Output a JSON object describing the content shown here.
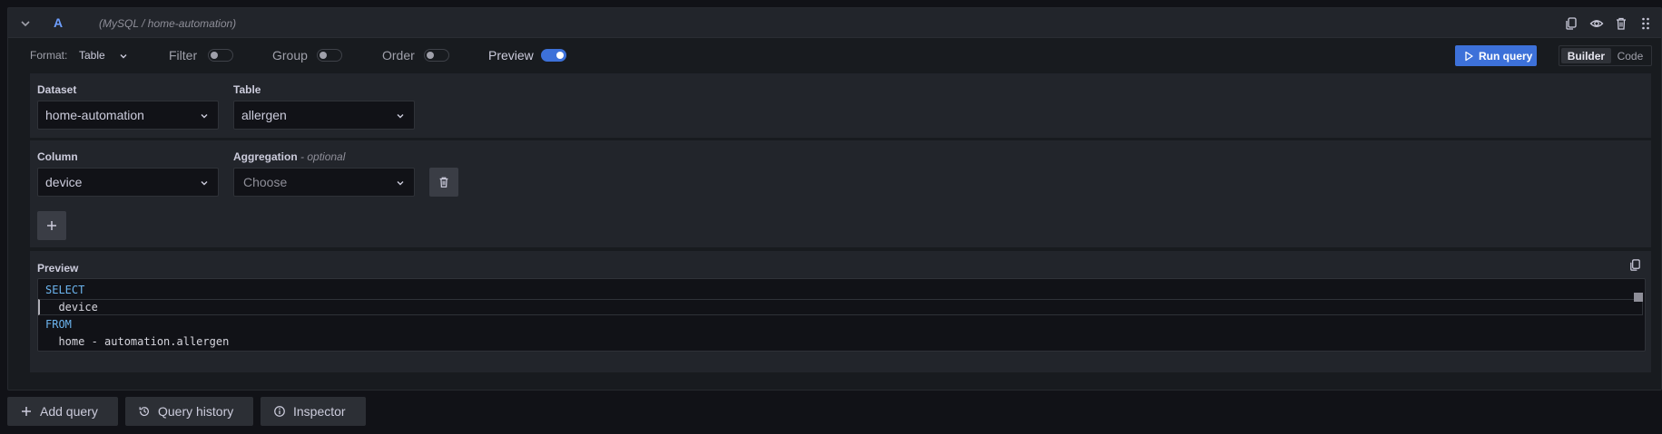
{
  "query": {
    "name": "A",
    "source": "(MySQL / home-automation)"
  },
  "toolbar": {
    "format_label": "Format:",
    "format_value": "Table",
    "filter_label": "Filter",
    "filter_on": false,
    "group_label": "Group",
    "group_on": false,
    "order_label": "Order",
    "order_on": false,
    "preview_label": "Preview",
    "preview_on": true,
    "run_query_label": "Run query",
    "mode_builder": "Builder",
    "mode_code": "Code",
    "active_mode": "Builder"
  },
  "dataset": {
    "label": "Dataset",
    "value": "home-automation"
  },
  "table": {
    "label": "Table",
    "value": "allergen"
  },
  "column": {
    "label": "Column",
    "value": "device"
  },
  "aggregation": {
    "label": "Aggregation",
    "optional_label": "- optional",
    "placeholder": "Choose"
  },
  "preview": {
    "title": "Preview",
    "lines": [
      {
        "kind": "keyword",
        "text": "SELECT"
      },
      {
        "kind": "text",
        "text": "  device"
      },
      {
        "kind": "keyword",
        "text": "FROM"
      },
      {
        "kind": "text",
        "text": "  home - automation.allergen"
      }
    ]
  },
  "bottom": {
    "add_query": "Add query",
    "query_history": "Query history",
    "inspector": "Inspector"
  },
  "colors": {
    "accent": "#3d71d9",
    "query_name": "#6e9fff",
    "sql_keyword": "#6cb4ee"
  },
  "icons": [
    "chevron-down-icon",
    "copy-icon",
    "eye-icon",
    "trash-icon",
    "drag-handle-icon",
    "play-icon",
    "plus-icon",
    "history-icon",
    "info-icon"
  ]
}
